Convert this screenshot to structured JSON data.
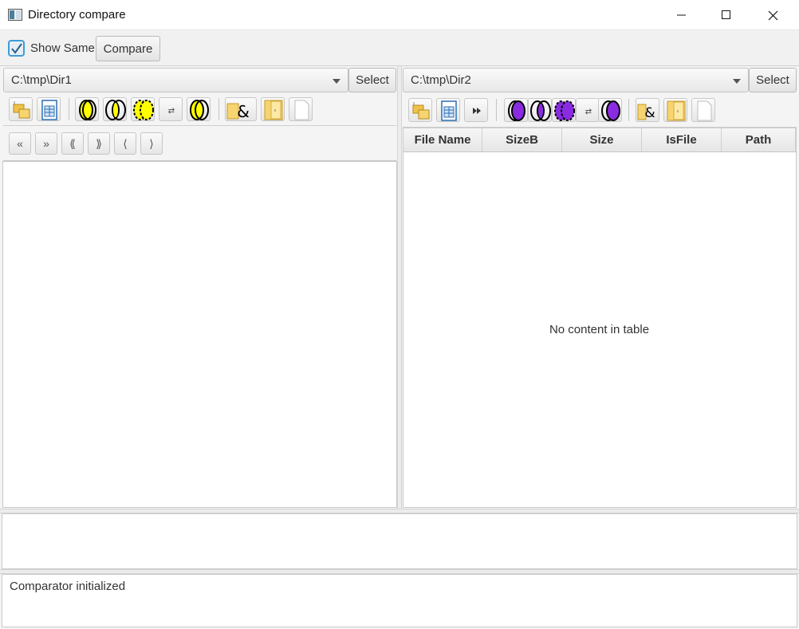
{
  "window": {
    "title": "Directory compare"
  },
  "toolbar": {
    "show_same_label": "Show Same",
    "show_same_checked": true,
    "compare_label": "Compare"
  },
  "left": {
    "path": "C:\\tmp\\Dir1",
    "select_label": "Select",
    "nav": [
      "«",
      "»",
      "⟪",
      "⟫",
      "⟨",
      "⟩"
    ],
    "icons": [
      "tree-folder-icon",
      "table-view-icon",
      "left-only-icon",
      "intersection-icon",
      "diff-icon",
      "swap-icon",
      "left-highlight-icon",
      "folder-ampersand-icon",
      "folder-open-icon",
      "blank-file-icon"
    ]
  },
  "right": {
    "path": "C:\\tmp\\Dir2",
    "select_label": "Select",
    "icons": [
      "tree-folder-icon",
      "table-view-icon",
      "fast-forward-icon",
      "right-only-icon",
      "intersection-icon",
      "diff-icon",
      "swap-icon",
      "right-highlight-icon",
      "folder-ampersand-icon",
      "folder-open-icon",
      "blank-file-icon"
    ],
    "table": {
      "columns": [
        "File Name",
        "SizeB",
        "Size",
        "IsFile",
        "Path"
      ],
      "empty_message": "No content in table"
    }
  },
  "status": {
    "message": "Comparator initialized"
  },
  "colors": {
    "yellow": "#ffff00",
    "purple": "#8a2be2",
    "accent": "#3d9bd6"
  }
}
